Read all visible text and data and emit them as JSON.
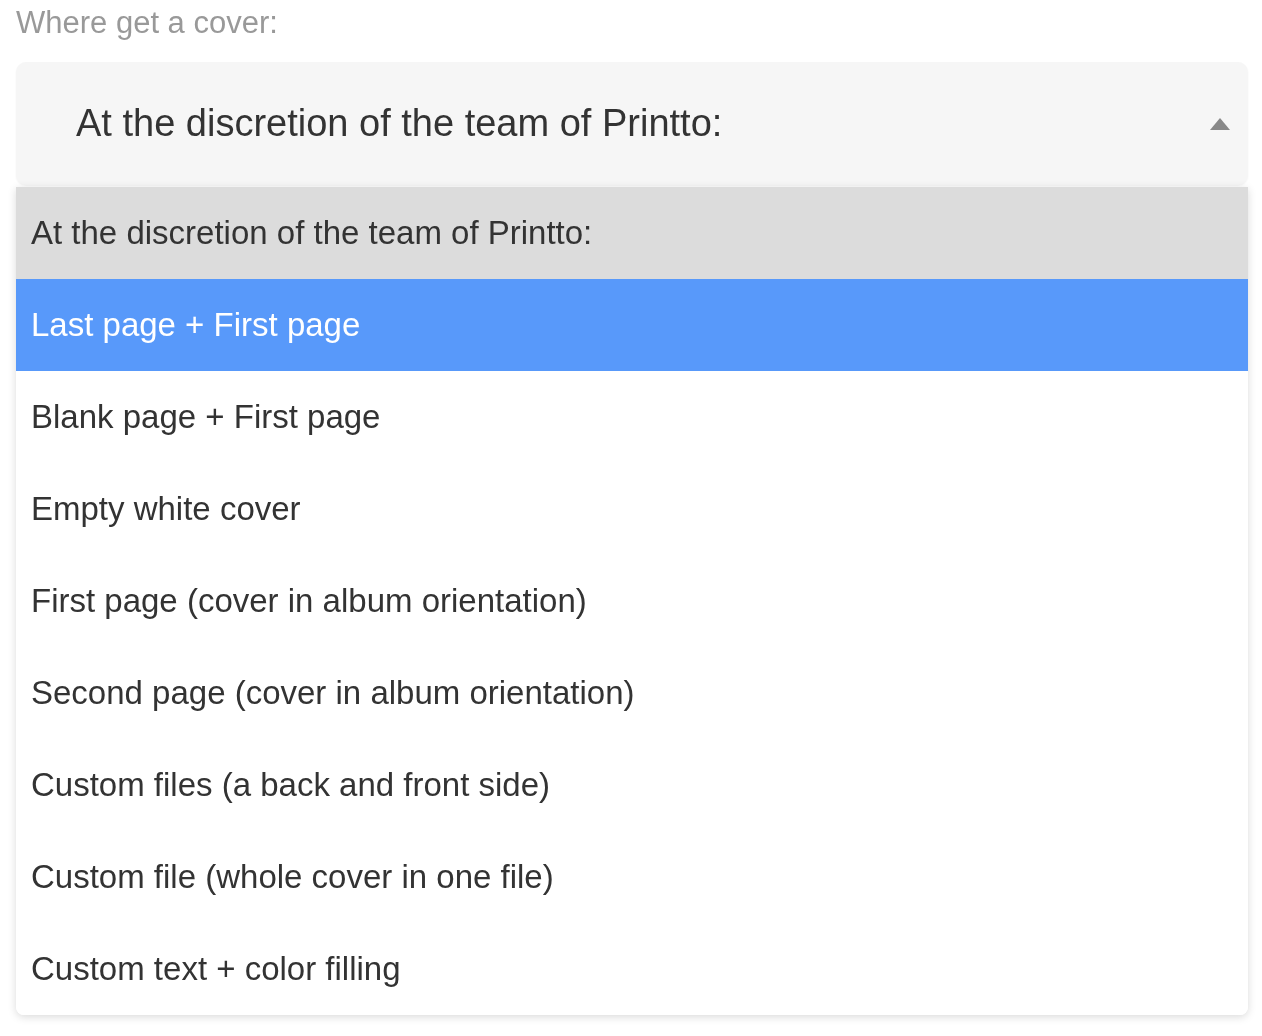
{
  "field_label": "Where get a cover:",
  "select": {
    "value": "At the discretion of the team of Printto:",
    "expanded": true
  },
  "options": [
    {
      "label": "At the discretion of the team of Printto:",
      "selected": true,
      "highlighted": false
    },
    {
      "label": "Last page + First page",
      "selected": false,
      "highlighted": true
    },
    {
      "label": "Blank page + First page",
      "selected": false,
      "highlighted": false
    },
    {
      "label": "Empty white cover",
      "selected": false,
      "highlighted": false
    },
    {
      "label": "First page (cover in album orientation)",
      "selected": false,
      "highlighted": false
    },
    {
      "label": "Second page (cover in album orientation)",
      "selected": false,
      "highlighted": false
    },
    {
      "label": "Custom files (a back and front side)",
      "selected": false,
      "highlighted": false
    },
    {
      "label": "Custom file (whole cover in one file)",
      "selected": false,
      "highlighted": false
    },
    {
      "label": "Custom text + color filling",
      "selected": false,
      "highlighted": false
    }
  ]
}
